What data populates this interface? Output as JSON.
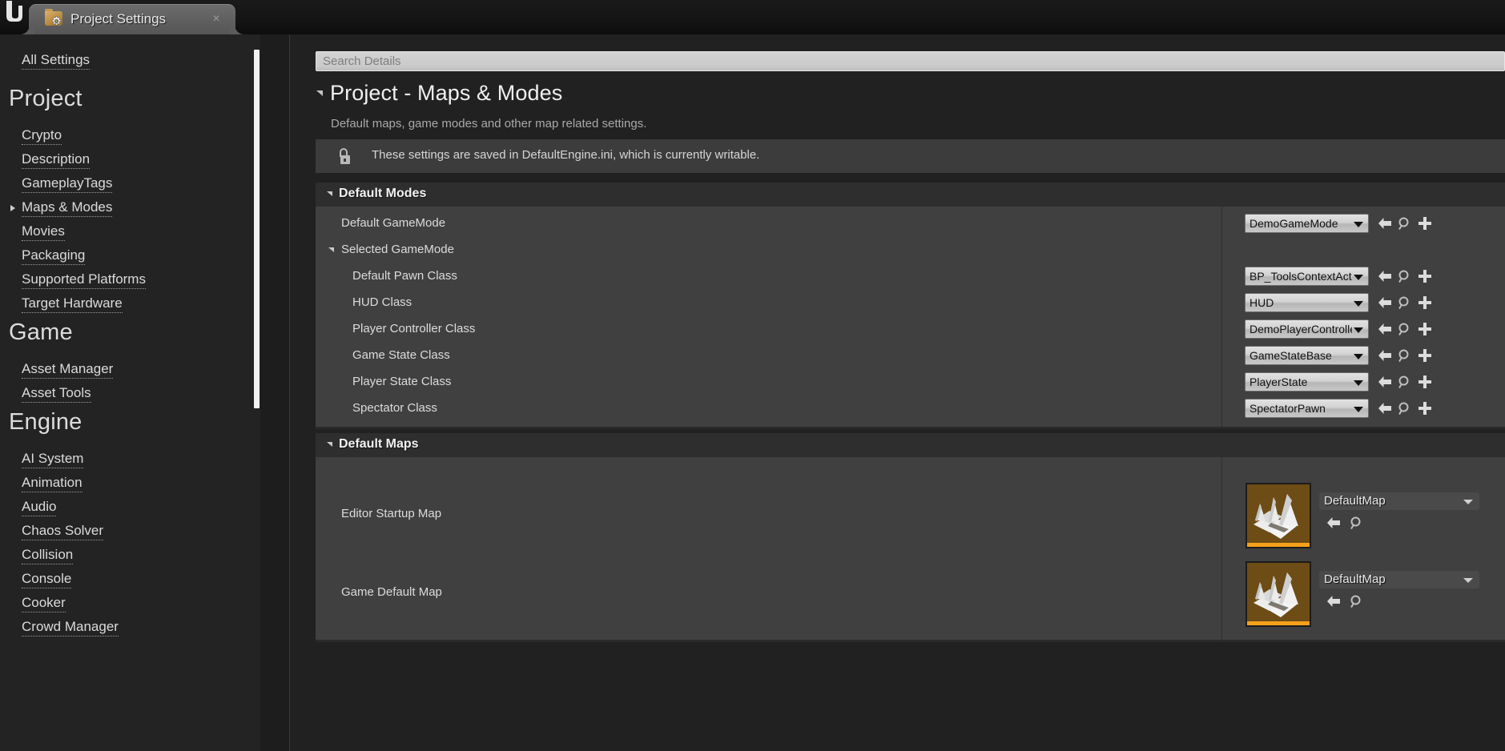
{
  "window": {
    "logo_glyph": "ƒ",
    "tab_title": "Project Settings",
    "tab_close_glyph": "×"
  },
  "sidebar": {
    "all_settings_label": "All Settings",
    "sections": [
      {
        "title": "Project",
        "items": [
          {
            "label": "Crypto",
            "expandable": false
          },
          {
            "label": "Description",
            "expandable": false
          },
          {
            "label": "GameplayTags",
            "expandable": false
          },
          {
            "label": "Maps & Modes",
            "expandable": true
          },
          {
            "label": "Movies",
            "expandable": false
          },
          {
            "label": "Packaging",
            "expandable": false
          },
          {
            "label": "Supported Platforms",
            "expandable": false
          },
          {
            "label": "Target Hardware",
            "expandable": false
          }
        ]
      },
      {
        "title": "Game",
        "items": [
          {
            "label": "Asset Manager",
            "expandable": false
          },
          {
            "label": "Asset Tools",
            "expandable": false
          }
        ]
      },
      {
        "title": "Engine",
        "items": [
          {
            "label": "AI System",
            "expandable": false
          },
          {
            "label": "Animation",
            "expandable": false
          },
          {
            "label": "Audio",
            "expandable": false
          },
          {
            "label": "Chaos Solver",
            "expandable": false
          },
          {
            "label": "Collision",
            "expandable": false
          },
          {
            "label": "Console",
            "expandable": false
          },
          {
            "label": "Cooker",
            "expandable": false
          },
          {
            "label": "Crowd Manager",
            "expandable": false
          }
        ]
      }
    ]
  },
  "details": {
    "search_placeholder": "Search Details",
    "page_title": "Project - Maps & Modes",
    "page_subtitle": "Default maps, game modes and other map related settings.",
    "notice_text": "These settings are saved in DefaultEngine.ini, which is currently writable.",
    "sections": [
      {
        "name": "default-modes",
        "title": "Default Modes",
        "rows": [
          {
            "label": "Default GameMode",
            "indent": 0,
            "expandable": false,
            "value": "DemoGameMode",
            "control": "combo-light"
          },
          {
            "label": "Selected GameMode",
            "indent": 0,
            "expandable": true,
            "value": null,
            "control": "none"
          },
          {
            "label": "Default Pawn Class",
            "indent": 1,
            "expandable": false,
            "value": "BP_ToolsContextActor",
            "control": "combo-light"
          },
          {
            "label": "HUD Class",
            "indent": 1,
            "expandable": false,
            "value": "HUD",
            "control": "combo-light"
          },
          {
            "label": "Player Controller Class",
            "indent": 1,
            "expandable": false,
            "value": "DemoPlayerController",
            "control": "combo-light"
          },
          {
            "label": "Game State Class",
            "indent": 1,
            "expandable": false,
            "value": "GameStateBase",
            "control": "combo-light"
          },
          {
            "label": "Player State Class",
            "indent": 1,
            "expandable": false,
            "value": "PlayerState",
            "control": "combo-light"
          },
          {
            "label": "Spectator Class",
            "indent": 1,
            "expandable": false,
            "value": "SpectatorPawn",
            "control": "combo-light"
          }
        ]
      },
      {
        "name": "default-maps",
        "title": "Default Maps",
        "rows": [
          {
            "label": "Editor Startup Map",
            "indent": 0,
            "expandable": false,
            "value": "DefaultMap",
            "control": "asset-picker"
          },
          {
            "label": "Game Default Map",
            "indent": 0,
            "expandable": false,
            "value": "DefaultMap",
            "control": "asset-picker"
          }
        ]
      }
    ],
    "row_icons": {
      "reset": "back-arrow-icon",
      "browse": "magnifier-icon",
      "create": "plus-icon"
    }
  },
  "colors": {
    "accent_orange": "#f5a11b",
    "panel_bg": "#404040",
    "section_header_bg": "#2e2e2e",
    "window_bg": "#212121",
    "sidebar_bg": "#232323",
    "thumbnail_bg": "#6d4c16"
  }
}
